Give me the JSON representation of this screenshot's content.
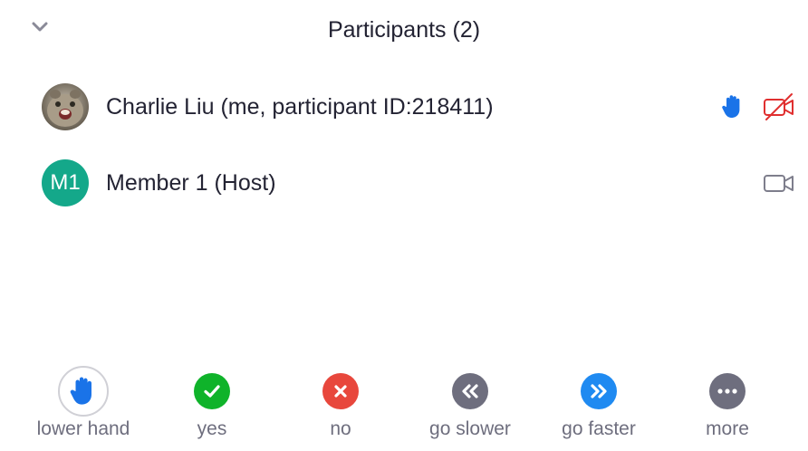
{
  "header": {
    "title": "Participants (2)",
    "collapse_icon": "chevron-down-icon"
  },
  "participants": [
    {
      "name": "Charlie Liu (me, participant ID:218411)",
      "avatar": "photo",
      "hand_raised": true,
      "video_on": false,
      "colors": {
        "hand": "#1a73e8",
        "video_off": "#e02f2f"
      }
    },
    {
      "name": "Member 1 (Host)",
      "initials": "M1",
      "avatar_color": "#14a88a",
      "hand_raised": false,
      "video_on": true
    }
  ],
  "reactions": [
    {
      "label": "lower hand",
      "icon": "raised-hand-icon",
      "color": "#ffffff"
    },
    {
      "label": "yes",
      "icon": "checkmark-icon",
      "color": "#0fb32a"
    },
    {
      "label": "no",
      "icon": "x-icon",
      "color": "#e8473c"
    },
    {
      "label": "go slower",
      "icon": "rewind-icon",
      "color": "#6e6e7e"
    },
    {
      "label": "go faster",
      "icon": "fast-forward-icon",
      "color": "#1f8af1"
    },
    {
      "label": "more",
      "icon": "ellipsis-icon",
      "color": "#6e6e7e"
    }
  ]
}
